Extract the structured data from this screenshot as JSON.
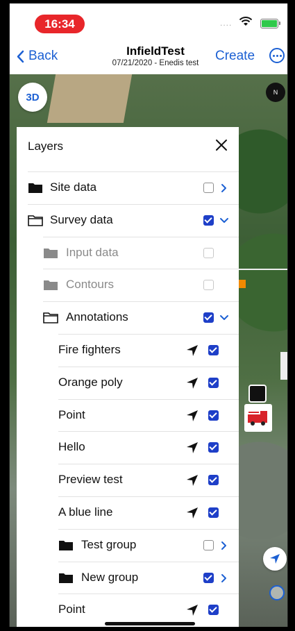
{
  "status_bar": {
    "time": "16:34",
    "signal": "....",
    "battery_color": "#30c94b"
  },
  "nav": {
    "back_label": "Back",
    "title": "InfieldTest",
    "subtitle": "07/21/2020 - Enedis test",
    "create_label": "Create"
  },
  "map": {
    "mode_label": "3D",
    "compass_label": "N"
  },
  "layers": {
    "title": "Layers",
    "rows": [
      {
        "label": "Site data",
        "icon": "folder-filled-icon",
        "checked": false,
        "control": "chevron-right"
      },
      {
        "label": "Survey data",
        "icon": "folder-outline-icon",
        "checked": true,
        "control": "chevron-down"
      },
      {
        "label": "Input data",
        "icon": "folder-filled-icon",
        "checked": false,
        "disabled": true
      },
      {
        "label": "Contours",
        "icon": "folder-filled-icon",
        "checked": false,
        "disabled": true
      },
      {
        "label": "Annotations",
        "icon": "folder-outline-icon",
        "checked": true,
        "control": "chevron-down"
      },
      {
        "label": "Fire fighters",
        "checked": true,
        "navigate": true
      },
      {
        "label": "Orange poly",
        "checked": true,
        "navigate": true
      },
      {
        "label": "Point",
        "checked": true,
        "navigate": true
      },
      {
        "label": "Hello",
        "checked": true,
        "navigate": true
      },
      {
        "label": "Preview test",
        "checked": true,
        "navigate": true
      },
      {
        "label": "A blue line",
        "checked": true,
        "navigate": true
      },
      {
        "label": "Test group",
        "icon": "folder-filled-icon",
        "checked": false,
        "control": "chevron-right"
      },
      {
        "label": "New group",
        "icon": "folder-filled-icon",
        "checked": true,
        "control": "chevron-right"
      },
      {
        "label": "Point",
        "checked": true,
        "navigate": true
      }
    ]
  },
  "colors": {
    "accent": "#1c60d3",
    "checkbox": "#1e3fc8",
    "time_pill": "#e8262a"
  }
}
